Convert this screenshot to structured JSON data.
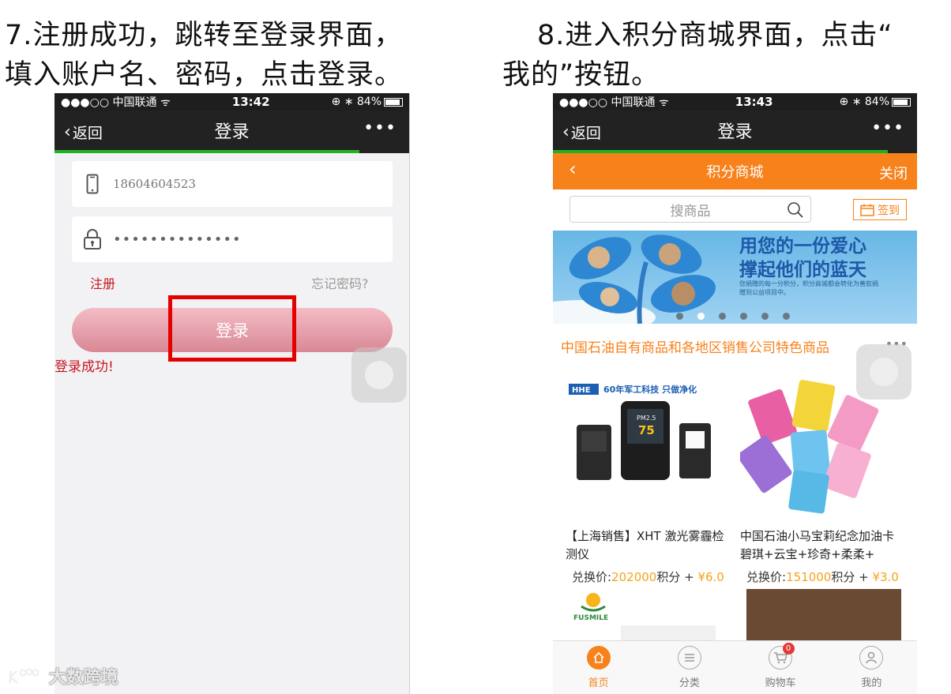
{
  "captions": {
    "left_line1": "7.注册成功，跳转至登录界面，",
    "left_line2": "填入账户名、密码，点击登录。",
    "right_line1": "8.进入积分商城界面，点击“",
    "right_line2": "我的”按钮。"
  },
  "left_phone": {
    "status": {
      "carrier": "●●●○○ 中国联通 ᯤ",
      "time": "13:42",
      "battery": "⊕ ∗ 84%"
    },
    "nav": {
      "back": "返回",
      "title": "登录",
      "more": "•••"
    },
    "progress_fraction": 0.86,
    "username_value": "18604604523",
    "password_value": "••••••••••••••",
    "register_link": "注册",
    "forgot_link": "忘记密码?",
    "login_button": "登录",
    "success_message": "登录成功!"
  },
  "watermark": "大数跨境",
  "right_phone": {
    "status": {
      "carrier": "●●●○○ 中国联通 ᯤ",
      "time": "13:43",
      "battery": "⊕ ∗ 84%"
    },
    "nav": {
      "back": "返回",
      "title": "登录",
      "more": "•••"
    },
    "progress_fraction": 0.92,
    "mall_bar": {
      "title": "积分商城",
      "close": "关闭"
    },
    "search_placeholder": "搜商品",
    "signin_button": "签到",
    "banner": {
      "line1": "用您的一份爱心",
      "line2": "撑起他们的蓝天",
      "line3": "您捐赠的每一分积分，积分商城都会转化为善款捐赠到公益项目中。"
    },
    "section_title": "中国石油自有商品和各地区销售公司特色商品",
    "section_more": "•••",
    "products": [
      {
        "brand_text": "60年军工科技  只做净化",
        "screen_pm": "PM2.5",
        "screen_value": "75",
        "name": "【上海销售】XHT 激光雾霾检测仪",
        "price_prefix": "兑换价:",
        "points": "202000",
        "points_suffix": "积分 + ",
        "cash": "¥6.0"
      },
      {
        "name": "中国石油小马宝莉纪念加油卡 碧琪+云宝+珍奇+柔柔+",
        "price_prefix": "兑换价:",
        "points": "151000",
        "points_suffix": "积分 + ",
        "cash": "¥3.0"
      }
    ],
    "third_product_logo_text": "FUSMILE",
    "tabs": [
      {
        "label": "首页",
        "icon": "home-icon",
        "active": true
      },
      {
        "label": "分类",
        "icon": "list-icon",
        "active": false
      },
      {
        "label": "购物车",
        "icon": "cart-icon",
        "active": false,
        "badge": "0"
      },
      {
        "label": "我的",
        "icon": "user-icon",
        "active": false
      }
    ]
  },
  "colors": {
    "mall_orange": "#f7821b",
    "highlight_red": "#e50000",
    "progress_green": "#21b021"
  }
}
